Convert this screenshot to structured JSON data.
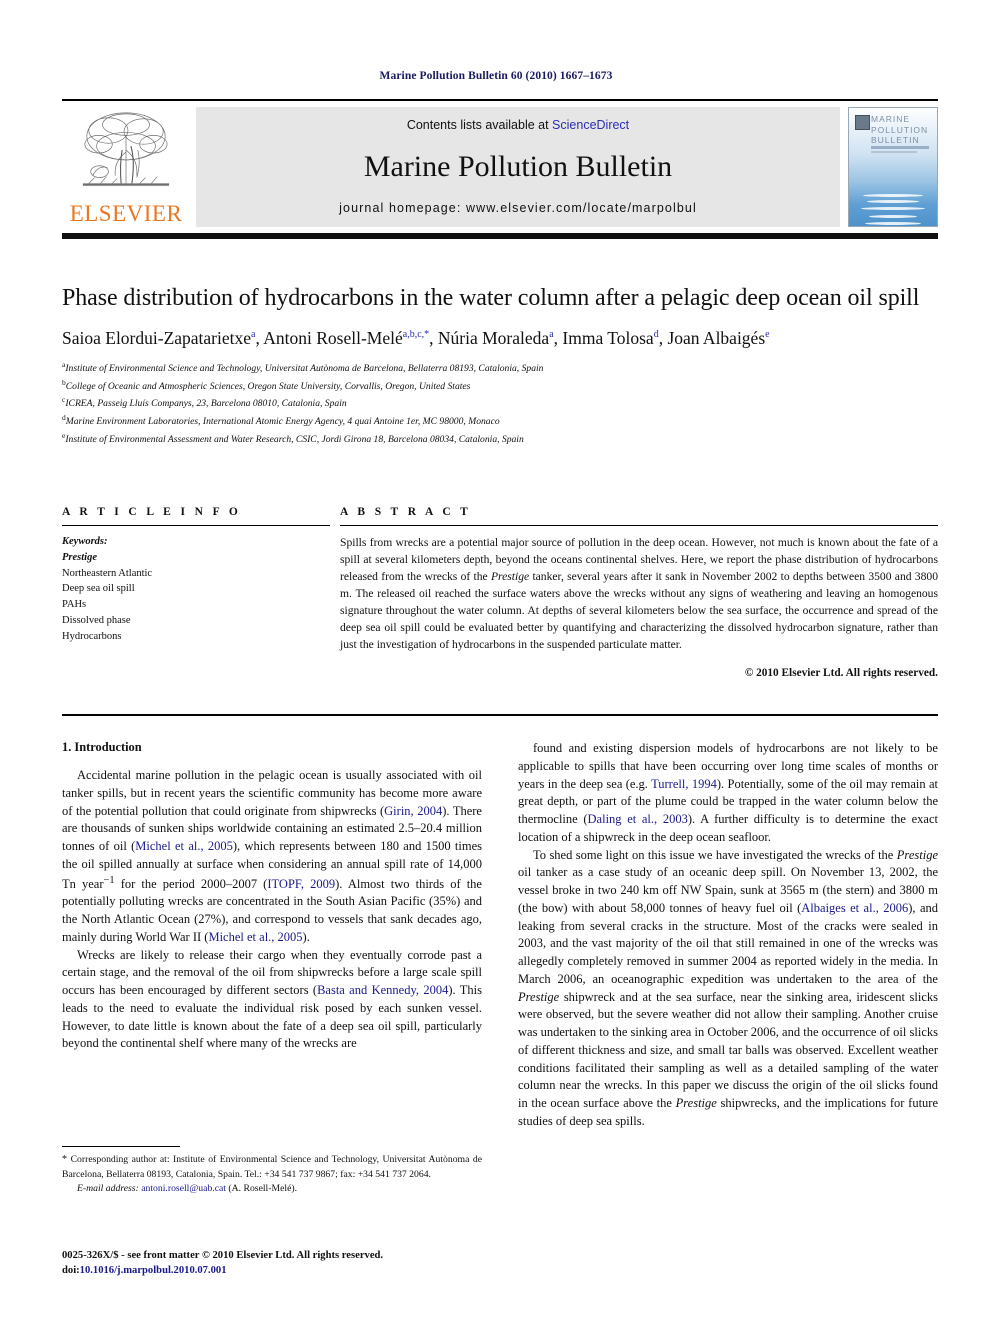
{
  "running_head": "Marine Pollution Bulletin 60 (2010) 1667–1673",
  "masthead": {
    "contents_prefix": "Contents lists available at ",
    "sciencedirect": "ScienceDirect",
    "journal_title": "Marine Pollution Bulletin",
    "homepage": "journal homepage: www.elsevier.com/locate/marpolbul",
    "publisher_logo_text": "ELSEVIER",
    "cover_title": "MARINE POLLUTION BULLETIN",
    "link_color": "#2d2db5",
    "elsevier_orange": "#e87722"
  },
  "article": {
    "title": "Phase distribution of hydrocarbons in the water column after a pelagic deep ocean oil spill",
    "authors": [
      {
        "name": "Saioa Elordui-Zapatarietxe",
        "marks": "a"
      },
      {
        "name": "Antoni Rosell-Melé",
        "marks": "a,b,c,*"
      },
      {
        "name": "Núria Moraleda",
        "marks": "a"
      },
      {
        "name": "Imma Tolosa",
        "marks": "d"
      },
      {
        "name": "Joan Albaigés",
        "marks": "e"
      }
    ],
    "affiliations": [
      {
        "mark": "a",
        "text": "Institute of Environmental Science and Technology, Universitat Autònoma de Barcelona, Bellaterra 08193, Catalonia, Spain"
      },
      {
        "mark": "b",
        "text": "College of Oceanic and Atmospheric Sciences, Oregon State University, Corvallis, Oregon, United States"
      },
      {
        "mark": "c",
        "text": "ICREA, Passeig Lluís Companys, 23, Barcelona 08010, Catalonia, Spain"
      },
      {
        "mark": "d",
        "text": "Marine Environment Laboratories, International Atomic Energy Agency, 4 quai Antoine 1er, MC 98000, Monaco"
      },
      {
        "mark": "e",
        "text": "Institute of Environmental Assessment and Water Research, CSIC, Jordi Girona 18, Barcelona 08034, Catalonia, Spain"
      }
    ]
  },
  "article_info": {
    "heading": "A R T I C L E    I N F O",
    "keywords_label": "Keywords:",
    "keywords": [
      {
        "text": "Prestige",
        "italic": true
      },
      {
        "text": "Northeastern Atlantic",
        "italic": false
      },
      {
        "text": "Deep sea oil spill",
        "italic": false
      },
      {
        "text": "PAHs",
        "italic": false
      },
      {
        "text": "Dissolved phase",
        "italic": false
      },
      {
        "text": "Hydrocarbons",
        "italic": false
      }
    ]
  },
  "abstract": {
    "heading": "A B S T R A C T",
    "paragraph_parts": [
      {
        "text": "Spills from wrecks are a potential major source of pollution in the deep ocean. However, not much is known about the fate of a spill at several kilometers depth, beyond the oceans continental shelves. Here, we report the phase distribution of hydrocarbons released from the wrecks of the ",
        "italic": false
      },
      {
        "text": "Prestige",
        "italic": true
      },
      {
        "text": " tanker, several years after it sank in November 2002 to depths between 3500 and 3800 m. The released oil reached the surface waters above the wrecks without any signs of weathering and leaving an homogenous signature throughout the water column. At depths of several kilometers below the sea surface, the occurrence and spread of the deep sea oil spill could be evaluated better by quantifying and characterizing the dissolved hydrocarbon signature, rather than just the investigation of hydrocarbons in the suspended particulate matter.",
        "italic": false
      }
    ],
    "copyright": "© 2010 Elsevier Ltd. All rights reserved."
  },
  "body": {
    "section_heading": "1. Introduction",
    "left_column": [
      {
        "parts": [
          {
            "text": "Accidental marine pollution in the pelagic ocean is usually associated with oil tanker spills, but in recent years the scientific community has become more aware of the potential pollution that could originate from shipwrecks (",
            "style": "normal"
          },
          {
            "text": "Girin, 2004",
            "style": "ref"
          },
          {
            "text": "). There are thousands of sunken ships worldwide containing an estimated 2.5–20.4 million tonnes of oil (",
            "style": "normal"
          },
          {
            "text": "Michel et al., 2005",
            "style": "ref"
          },
          {
            "text": "), which represents between 180 and 1500 times the oil spilled annually at surface when considering an annual spill rate of 14,000 Tn year",
            "style": "normal"
          },
          {
            "text": "−1",
            "style": "sup"
          },
          {
            "text": " for the period 2000–2007 (",
            "style": "normal"
          },
          {
            "text": "ITOPF, 2009",
            "style": "ref"
          },
          {
            "text": "). Almost two thirds of the potentially polluting wrecks are concentrated in the South Asian Pacific (35%) and the North Atlantic Ocean (27%), and correspond to vessels that sank decades ago, mainly during World War II (",
            "style": "normal"
          },
          {
            "text": "Michel et al., 2005",
            "style": "ref"
          },
          {
            "text": ").",
            "style": "normal"
          }
        ]
      },
      {
        "parts": [
          {
            "text": "Wrecks are likely to release their cargo when they eventually corrode past a certain stage, and the removal of the oil from shipwrecks before a large scale spill occurs has been encouraged by different sectors (",
            "style": "normal"
          },
          {
            "text": "Basta and Kennedy, 2004",
            "style": "ref"
          },
          {
            "text": "). This leads to the need to evaluate the individual risk posed by each sunken vessel. However, to date little is known about the fate of a deep sea oil spill, particularly beyond the continental shelf where many of the wrecks are",
            "style": "normal"
          }
        ]
      }
    ],
    "right_column": [
      {
        "parts": [
          {
            "text": "found and existing dispersion models of hydrocarbons are not likely to be applicable to spills that have been occurring over long time scales of months or years in the deep sea (e.g. ",
            "style": "normal"
          },
          {
            "text": "Turrell, 1994",
            "style": "ref"
          },
          {
            "text": "). Potentially, some of the oil may remain at great depth, or part of the plume could be trapped in the water column below the thermocline (",
            "style": "normal"
          },
          {
            "text": "Daling et al., 2003",
            "style": "ref"
          },
          {
            "text": "). A further difficulty is to determine the exact location of a shipwreck in the deep ocean seafloor.",
            "style": "normal"
          }
        ],
        "no_indent": false
      },
      {
        "parts": [
          {
            "text": "To shed some light on this issue we have investigated the wrecks of the ",
            "style": "normal"
          },
          {
            "text": "Prestige",
            "style": "italic"
          },
          {
            "text": " oil tanker as a case study of an oceanic deep spill. On November 13, 2002, the vessel broke in two 240 km off NW Spain, sunk at 3565 m (the stern) and 3800 m (the bow) with about 58,000 tonnes of heavy fuel oil (",
            "style": "normal"
          },
          {
            "text": "Albaiges et al., 2006",
            "style": "ref"
          },
          {
            "text": "), and leaking from several cracks in the structure. Most of the cracks were sealed in 2003, and the vast majority of the oil that still remained in one of the wrecks was allegedly completely removed in summer 2004 as reported widely in the media. In March 2006, an oceanographic expedition was undertaken to the area of the ",
            "style": "normal"
          },
          {
            "text": "Prestige",
            "style": "italic"
          },
          {
            "text": " shipwreck and at the sea surface, near the sinking area, iridescent slicks were observed, but the severe weather did not allow their sampling. Another cruise was undertaken to the sinking area in October 2006, and the occurrence of oil slicks of different thickness and size, and small tar balls was observed. Excellent weather conditions facilitated their sampling as well as a detailed sampling of the water column near the wrecks. In this paper we discuss the origin of the oil slicks found in the ocean surface above the ",
            "style": "normal"
          },
          {
            "text": "Prestige",
            "style": "italic"
          },
          {
            "text": " shipwrecks, and the implications for future studies of deep sea spills.",
            "style": "normal"
          }
        ]
      }
    ]
  },
  "footnotes": {
    "corresponding": [
      {
        "text": "* ",
        "style": "star"
      },
      {
        "text": "Corresponding author at: Institute of Environmental Science and Technology, Universitat Autònoma de Barcelona, Bellaterra 08193, Catalonia, Spain. Tel.: +34 541 737 9867; fax: +34 541 737 2064.",
        "style": "normal"
      }
    ],
    "email_label": "E-mail address:",
    "email": "antoni.rosell@uab.cat",
    "email_author": "(A. Rosell-Melé)."
  },
  "imprint": {
    "issn_line": "0025-326X/$ - see front matter © 2010 Elsevier Ltd. All rights reserved.",
    "doi_label": "doi:",
    "doi": "10.1016/j.marpolbul.2010.07.001"
  }
}
